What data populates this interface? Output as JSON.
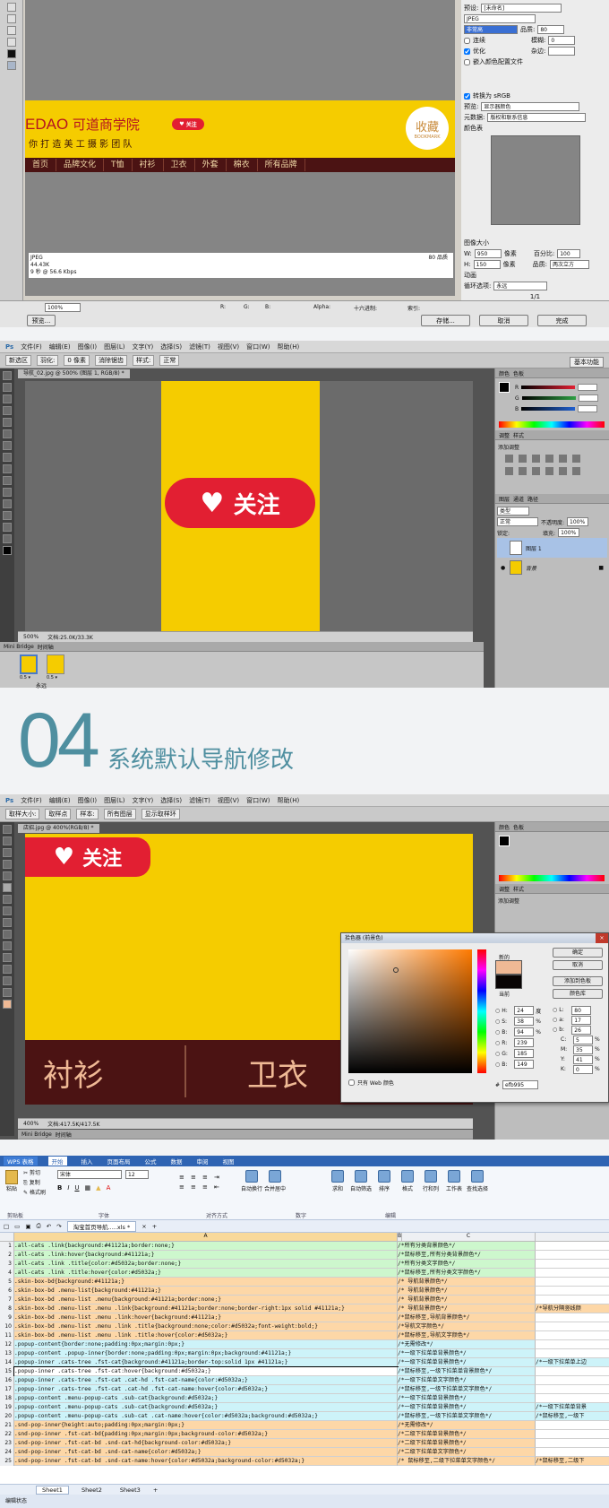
{
  "s1": {
    "right_panel": {
      "preset_label": "预设:",
      "preset_value": "[未命名]",
      "format": "JPEG",
      "quality_level": "非常高",
      "quality_label": "品质:",
      "quality": "80",
      "progressive": "连续",
      "blur_label": "模糊:",
      "blur": "0",
      "optimized": "优化",
      "matte_label": "杂边:",
      "embed": "嵌入颜色配置文件",
      "convert": "转换为 sRGB",
      "preview_label": "预览:",
      "preview_value": "显示器颜色",
      "metadata_label": "元数据:",
      "metadata_value": "版权和联系信息",
      "color_table": "颜色表",
      "image_size": "图像大小",
      "w_label": "W:",
      "w": "950",
      "h_label": "H:",
      "h": "150",
      "unit": "像素",
      "percent_label": "百分比:",
      "percent": "100",
      "quality2_label": "品质:",
      "quality2": "两次立方",
      "anim": "动画",
      "loop_label": "循环选项:",
      "loop": "永远",
      "frame": "1/1"
    },
    "canvas": {
      "brand": "EDAO",
      "brand_cn": "可道商学院",
      "slogan": "你 打 造 美 工 摄 影 团 队",
      "follow": "关注",
      "badge1": "收藏",
      "badge2": "BOOKMARK",
      "nav": [
        "首页",
        "品牌文化",
        "T恤",
        "衬衫",
        "卫衣",
        "外套",
        "棉衣",
        "所有品牌"
      ],
      "info": [
        "JPEG",
        "44.43K",
        "9 秒 @ 56.6 Kbps"
      ],
      "quality_note": "80 品质"
    },
    "bottom": {
      "zoom": "100%",
      "alpha": "Alpha:",
      "hex": "十六进制:",
      "index": "索引:",
      "preview": "预览...",
      "save": "存储...",
      "cancel": "取消",
      "done": "完成",
      "r": "R:",
      "g": "G:",
      "b": "B:"
    }
  },
  "s2": {
    "app_icon": "Ps",
    "menu": [
      "文件(F)",
      "编辑(E)",
      "图像(I)",
      "图层(L)",
      "文字(Y)",
      "选择(S)",
      "滤镜(T)",
      "视图(V)",
      "窗口(W)",
      "帮助(H)"
    ],
    "workspace": "基本功能",
    "options": [
      "新选区",
      "羽化:",
      "0 像素",
      "消除锯齿",
      "样式:",
      "正常"
    ],
    "doc_tab": "导航_02.jpg @ 500% (图层 1, RGB/8) *",
    "follow": "关注",
    "zoom": "500%",
    "doc_size": "文档:25.0K/33.3K",
    "panels": [
      "颜色",
      "色板",
      "调整",
      "样式",
      "图层",
      "通道",
      "路径"
    ],
    "add_adjust": "添加调整",
    "layer_kind": "类型",
    "blend": "正常",
    "opacity_label": "不透明度:",
    "opacity": "100%",
    "lock": "锁定:",
    "fill_label": "填充:",
    "fill": "100%",
    "layers": [
      "图层 1",
      "背景"
    ],
    "rgb": [
      "R",
      "G",
      "B"
    ],
    "bottom_tabs": [
      "Mini Bridge",
      "时间轴"
    ],
    "frame_time": "0.5 ▾",
    "loop": "永远"
  },
  "s3": {
    "number": "04",
    "title": "系统默认导航修改"
  },
  "s4": {
    "menu": [
      "文件(F)",
      "编辑(E)",
      "图像(I)",
      "图层(L)",
      "文字(Y)",
      "选择(S)",
      "滤镜(T)",
      "视图(V)",
      "窗口(W)",
      "帮助(H)"
    ],
    "options": [
      "取样大小:",
      "取样点",
      "样本:",
      "所有图层",
      "显示取样环"
    ],
    "doc_tab": "店招.jpg @ 400%(RGB/8) *",
    "follow": "关注",
    "nav": [
      "衬衫",
      "卫衣"
    ],
    "zoom": "400%",
    "doc_size": "文档:417.5K/417.5K",
    "picker": {
      "title": "拾色器 (前景色)",
      "new": "新的",
      "current": "当前",
      "ok": "确定",
      "cancel": "取消",
      "add": "添加到色板",
      "libs": "颜色库",
      "web_only": "只有 Web 颜色",
      "fields": [
        [
          "H:",
          "24",
          "度"
        ],
        [
          "S:",
          "38",
          "%"
        ],
        [
          "B:",
          "94",
          "%"
        ],
        [
          "R:",
          "239",
          ""
        ],
        [
          "G:",
          "185",
          ""
        ],
        [
          "B:",
          "149",
          ""
        ]
      ],
      "lab": [
        [
          "L:",
          "80"
        ],
        [
          "a:",
          "17"
        ],
        [
          "b:",
          "26"
        ]
      ],
      "cmyk": [
        [
          "C:",
          "5",
          "%"
        ],
        [
          "M:",
          "35",
          "%"
        ],
        [
          "Y:",
          "41",
          "%"
        ],
        [
          "K:",
          "0",
          "%"
        ]
      ],
      "hex": "efb995",
      "new_color": "#efb995",
      "current_color": "#080404"
    },
    "bottom_tabs": [
      "Mini Bridge",
      "时间轴"
    ]
  },
  "s5": {
    "app": "WPS 表格",
    "tabs": [
      "开始",
      "插入",
      "页面布局",
      "公式",
      "数据",
      "审阅",
      "视图"
    ],
    "clipboard": [
      "剪切",
      "复制",
      "格式刷",
      "粘贴"
    ],
    "font": "宋体",
    "size": "12",
    "groups": [
      "剪贴板",
      "字体",
      "对齐方式",
      "数字",
      "编辑"
    ],
    "ribbon": [
      "自动换行",
      "合并居中",
      "求和",
      "自动筛选",
      "排序",
      "格式",
      "行和列",
      "工作表",
      "查找选择"
    ],
    "doc_tab": "淘宝首页导航.....xls *",
    "cell_ref": "A15",
    "cols": [
      "A",
      "B",
      "C"
    ],
    "rows": [
      {
        "n": "1",
        "a": ".all-cats .link{background:#41121a;border:none;}",
        "b": "/*所有分类背景颜色*/",
        "c": "",
        "t": "g"
      },
      {
        "n": "2",
        "a": ".all-cats .link:hover{background:#41121a;}",
        "b": "/*鼠标移至,所有分类背景颜色*/",
        "c": "",
        "t": "g"
      },
      {
        "n": "3",
        "a": ".all-cats .link .title{color:#d5032a;border:none;}",
        "b": "/*所有分类文字颜色*/",
        "c": "",
        "t": "g"
      },
      {
        "n": "4",
        "a": ".all-cats .link .title:hover{color:#d5032a;}",
        "b": "/*鼠标移至,所有分类文字颜色*/",
        "c": "",
        "t": "g"
      },
      {
        "n": "5",
        "a": ".skin-box-bd{background:#41121a;}",
        "b": "/* 导航背景颜色*/",
        "c": "",
        "t": "o"
      },
      {
        "n": "6",
        "a": ".skin-box-bd .menu-list{background:#41121a;}",
        "b": "/* 导航背景颜色*/",
        "c": "",
        "t": "o"
      },
      {
        "n": "7",
        "a": ".skin-box-bd .menu-list .menu{background:#41121a;border:none;}",
        "b": "/* 导航背景颜色*/",
        "c": "",
        "t": "o"
      },
      {
        "n": "8",
        "a": ".skin-box-bd .menu-list .menu .link{background:#41121a;border:none;border-right:1px solid #41121a;}",
        "b": "/* 导航背景颜色*/",
        "c": "/*导航分隔竖线颜",
        "t": "o"
      },
      {
        "n": "9",
        "a": ".skin-box-bd .menu-list .menu .link:hover{background:#41121a;}",
        "b": "/*鼠标移至,导航背景颜色*/",
        "c": "",
        "t": "o"
      },
      {
        "n": "10",
        "a": ".skin-box-bd .menu-list .menu .link .title{background:none;color:#d5032a;font-weight:bold;}",
        "b": "/*导航文字颜色*/",
        "c": "",
        "t": "o"
      },
      {
        "n": "11",
        "a": ".skin-box-bd .menu-list .menu .link .title:hover{color:#d5032a;}",
        "b": "/*鼠标移至,导航文字颜色*/",
        "c": "",
        "t": "o"
      },
      {
        "n": "12",
        "a": ".popup-content{border:none;padding:0px;margin:0px;}",
        "b": "/*无需修改*/",
        "c": "",
        "t": "b"
      },
      {
        "n": "13",
        "a": ".popup-content .popup-inner{border:none;padding:0px;margin:0px;background:#41121a;}",
        "b": "/*一级下拉菜单背景颜色*/",
        "c": "",
        "t": "b"
      },
      {
        "n": "14",
        "a": ".popup-inner .cats-tree .fst-cat{background:#41121a;border-top:solid 1px #41121a;}",
        "b": "/*一级下拉菜单背景颜色*/",
        "c": "/*一级下拉菜单上边",
        "t": "b"
      },
      {
        "n": "15",
        "a": ".popup-inner .cats-tree .fst-cat:hover{background:#d5032a;}",
        "b": "/*鼠标移至,一级下拉菜单背景颜色*/",
        "c": "",
        "t": "b"
      },
      {
        "n": "16",
        "a": ".popup-inner .cats-tree .fst-cat .cat-hd .fst-cat-name{color:#d5032a;}",
        "b": "/*一级下拉菜单文字颜色*/",
        "c": "",
        "t": "b"
      },
      {
        "n": "17",
        "a": ".popup-inner .cats-tree .fst-cat .cat-hd .fst-cat-name:hover{color:#d5032a;}",
        "b": "/*鼠标移至,一级下拉菜单文字颜色*/",
        "c": "",
        "t": "b"
      },
      {
        "n": "18",
        "a": ".popup-content .menu-popup-cats .sub-cat{background:#d5032a;}",
        "b": "/*一级下拉菜单背景颜色*/",
        "c": "",
        "t": "b"
      },
      {
        "n": "19",
        "a": ".popup-content .menu-popup-cats .sub-cat{background:#d5032a;}",
        "b": "/*一级下拉菜单背景颜色*/",
        "c": "/*一级下拉菜单背景",
        "t": "b"
      },
      {
        "n": "20",
        "a": ".popup-content .menu-popup-cats .sub-cat .cat-name:hover{color:#d5032a;background:#d5032a;}",
        "b": "/*鼠标移至,一级下拉菜单文字颜色*/",
        "c": "/*鼠标移至,一级下",
        "t": "b"
      },
      {
        "n": "21",
        "a": ".snd-pop-inner{height:auto;padding:0px;margin:0px;}",
        "b": "/*无需修改*/",
        "c": "",
        "t": "o"
      },
      {
        "n": "22",
        "a": ".snd-pop-inner .fst-cat-bd{padding:0px;margin:0px;background-color:#d5032a;}",
        "b": "/*二级下拉菜单背景颜色*/",
        "c": "",
        "t": "o"
      },
      {
        "n": "23",
        "a": ".snd-pop-inner .fst-cat-bd .snd-cat-hd{background-color:#d5032a;}",
        "b": "/*二级下拉菜单背景颜色*/",
        "c": "",
        "t": "o"
      },
      {
        "n": "24",
        "a": ".snd-pop-inner .fst-cat-bd .snd-cat-name{color:#d5032a;}",
        "b": "/*二级下拉菜单文字颜色*/",
        "c": "",
        "t": "o"
      },
      {
        "n": "25",
        "a": ".snd-pop-inner .fst-cat-bd .snd-cat-name:hover{color:#d5032a;background-color:#d5032a;}",
        "b": "/* 鼠标移至,二级下拉菜单文字颜色*/",
        "c": "/*鼠标移至,二级下",
        "t": "o"
      }
    ],
    "sheets": [
      "Sheet1",
      "Sheet2",
      "Sheet3"
    ],
    "status": "编辑状态"
  },
  "colors": {
    "yellow": "#f5cc00",
    "brown": "#4b1313",
    "red": "#e21f32",
    "teal": "#4f8fa0",
    "highlight": "#efb995"
  }
}
